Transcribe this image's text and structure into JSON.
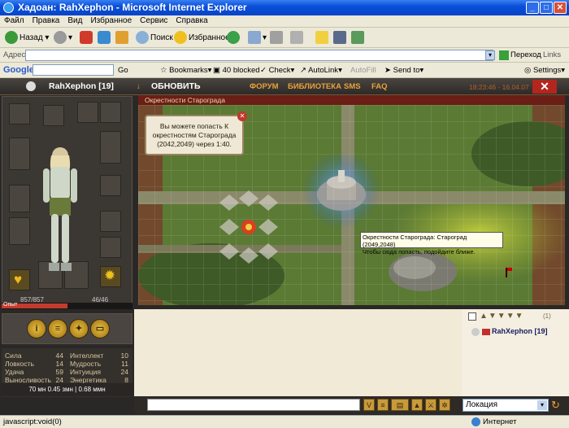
{
  "window": {
    "title": "Хадоан: RahXephon - Microsoft Internet Explorer"
  },
  "menu": [
    "Файл",
    "Правка",
    "Вид",
    "Избранное",
    "Сервис",
    "Справка"
  ],
  "toolbar": {
    "back": "Назад",
    "search": "Поиск",
    "favorites": "Избранное"
  },
  "address": {
    "label": "Адрес",
    "value": "",
    "go": "Переход",
    "links": "Links"
  },
  "googlebar": {
    "logo": "Google",
    "go": "Go",
    "bookmarks": "Bookmarks",
    "blocked": "40 blocked",
    "check": "Check",
    "autolink": "AutoLink",
    "autofill": "AutoFill",
    "send": "Send to",
    "settings": "Settings"
  },
  "game": {
    "player": "RahXephon [19]",
    "refresh": "ОБНОВИТЬ",
    "links": [
      "ФОРУМ",
      "БИБЛИОТЕКА",
      "SMS",
      "FAQ"
    ],
    "time": "18:23:46 - 16.04.07",
    "map_title": "Окрестности Старограда",
    "popup_text": "Вы можете попасть К окрестностям Старограда (2042,2049) через 1:40.",
    "tooltip_line1": "Окрестности Старограда: Староград (2049,2048)",
    "tooltip_line2": "Чтобы сюда попасть, подойдите ближе.",
    "hp": "857/857",
    "mp": "46/46",
    "hp_label": "Опыт",
    "hp_fraction": 0.5,
    "stats_left": [
      [
        "Сила",
        "44"
      ],
      [
        "Ловкость",
        "14"
      ],
      [
        "Удача",
        "59"
      ],
      [
        "Выносливость",
        "24"
      ]
    ],
    "stats_right": [
      [
        "Интеллект",
        "10"
      ],
      [
        "Мудрость",
        "11"
      ],
      [
        "Интуиция",
        "24"
      ],
      [
        "Энергетика",
        "8"
      ]
    ],
    "mana_line": "70 мн  0.45 змн | 0.68 ммн",
    "location_select": "Локация",
    "online_name": "RahXephon [19]",
    "online_count": "(1)"
  },
  "status": {
    "text": "javascript:void(0)",
    "zone": "Интернет"
  }
}
